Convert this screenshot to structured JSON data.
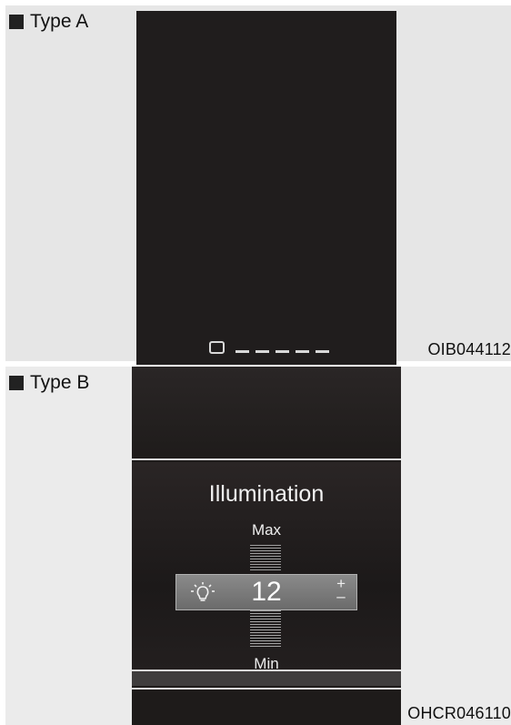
{
  "panel_a": {
    "label": "Type A",
    "code": "OIB044112"
  },
  "panel_b": {
    "label": "Type B",
    "code": "OHCR046110",
    "title": "Illumination",
    "max_label": "Max",
    "min_label": "Min",
    "value": "12",
    "plus": "+",
    "minus": "–",
    "icon": "bulb-icon"
  }
}
